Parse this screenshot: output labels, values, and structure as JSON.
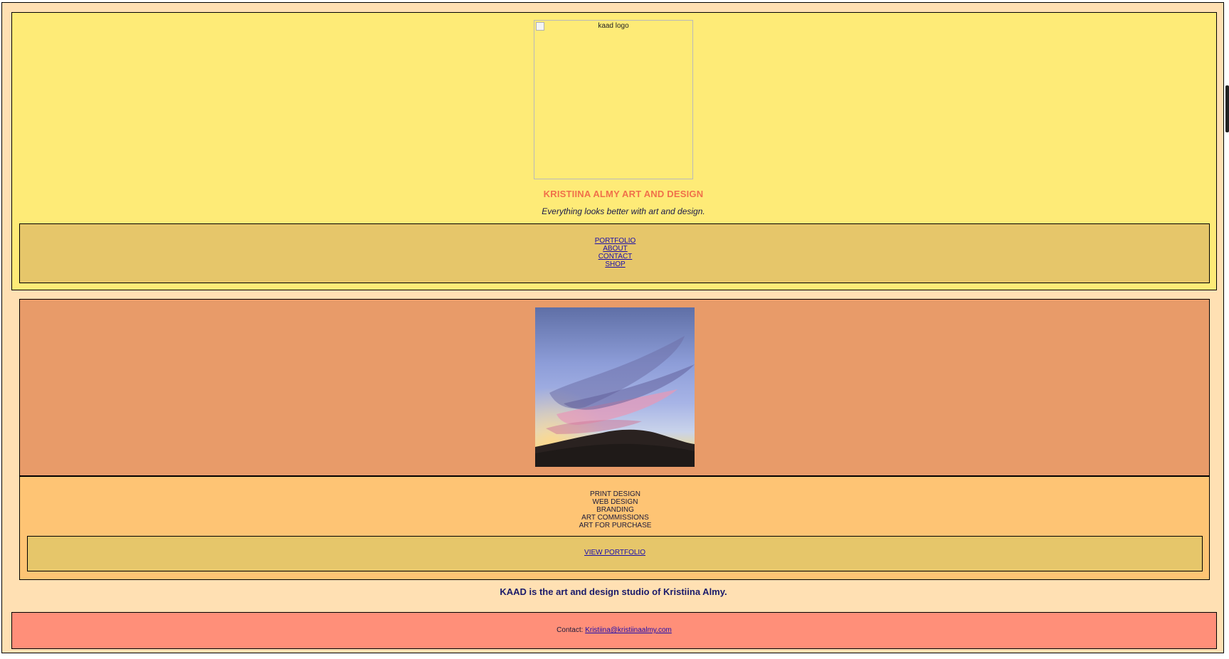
{
  "header": {
    "logo_alt": "kaad logo",
    "title": "KRISTIINA ALMY ART AND DESIGN",
    "tagline": "Everything looks better with art and design."
  },
  "nav": {
    "items": [
      {
        "label": "PORTFOLIO"
      },
      {
        "label": "ABOUT"
      },
      {
        "label": "CONTACT"
      },
      {
        "label": "SHOP"
      }
    ]
  },
  "services": {
    "items": [
      "PRINT DESIGN",
      "WEB DESIGN",
      "BRANDING",
      "ART COMMISSIONS",
      "ART FOR PURCHASE"
    ],
    "cta_label": "VIEW PORTFOLIO"
  },
  "about": {
    "text": "KAAD is the art and design studio of Kristiina Almy."
  },
  "footer": {
    "contact_label": "Contact:",
    "email": "Kristiina@kristiinaalmy.com"
  },
  "colors": {
    "header_bg": "#feeb77",
    "nav_bg": "#e6c66a",
    "hero_bg": "#e89b69",
    "services_bg": "#fec474",
    "page_bg": "#ffe0b3",
    "footer_bg": "#ff8f79",
    "title_color": "#f0704a",
    "link_color": "#1a0dab"
  },
  "icons": {
    "broken_image": "broken-image-icon"
  }
}
